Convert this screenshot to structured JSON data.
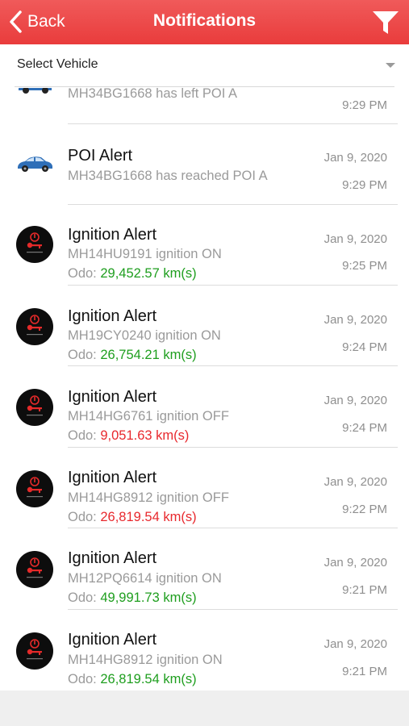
{
  "header": {
    "back_label": "Back",
    "title": "Notifications",
    "accent_color": "#ea4040"
  },
  "selector": {
    "label": "Select Vehicle"
  },
  "notifications": [
    {
      "type": "poi",
      "icon": "car-icon",
      "title": "",
      "message": "MH34BG1668 has left POI A",
      "date": "",
      "time": "9:29 PM"
    },
    {
      "type": "poi",
      "icon": "car-icon",
      "title": "POI Alert",
      "message": "MH34BG1668 has reached POI A",
      "date": "Jan 9, 2020",
      "time": "9:29 PM"
    },
    {
      "type": "ignition",
      "icon": "ignition-key-icon",
      "title": "Ignition Alert",
      "message": "MH14HU9191 ignition ON",
      "odo_label": "Odo: ",
      "odo_value": "29,452.57 km(s)",
      "status": "on",
      "date": "Jan 9, 2020",
      "time": "9:25 PM"
    },
    {
      "type": "ignition",
      "icon": "ignition-key-icon",
      "title": "Ignition Alert",
      "message": "MH19CY0240 ignition ON",
      "odo_label": "Odo: ",
      "odo_value": "26,754.21 km(s)",
      "status": "on",
      "date": "Jan 9, 2020",
      "time": "9:24 PM"
    },
    {
      "type": "ignition",
      "icon": "ignition-key-icon",
      "title": "Ignition Alert",
      "message": "MH14HG6761 ignition OFF",
      "odo_label": "Odo: ",
      "odo_value": "9,051.63 km(s)",
      "status": "off",
      "date": "Jan 9, 2020",
      "time": "9:24 PM"
    },
    {
      "type": "ignition",
      "icon": "ignition-key-icon",
      "title": "Ignition Alert",
      "message": "MH14HG8912 ignition OFF",
      "odo_label": "Odo: ",
      "odo_value": "26,819.54 km(s)",
      "status": "off",
      "date": "Jan 9, 2020",
      "time": "9:22 PM"
    },
    {
      "type": "ignition",
      "icon": "ignition-key-icon",
      "title": "Ignition Alert",
      "message": "MH12PQ6614 ignition ON",
      "odo_label": "Odo: ",
      "odo_value": "49,991.73 km(s)",
      "status": "on",
      "date": "Jan 9, 2020",
      "time": "9:21 PM"
    },
    {
      "type": "ignition",
      "icon": "ignition-key-icon",
      "title": "Ignition Alert",
      "message": "MH14HG8912 ignition ON",
      "odo_label": "Odo: ",
      "odo_value": "26,819.54 km(s)",
      "status": "on",
      "date": "Jan 9, 2020",
      "time": "9:21 PM"
    }
  ]
}
